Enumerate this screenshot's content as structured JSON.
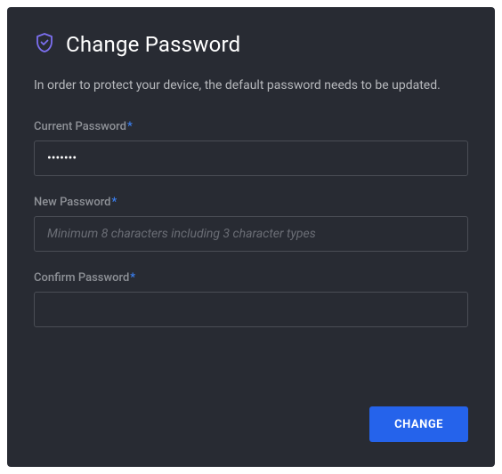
{
  "header": {
    "title": "Change Password"
  },
  "description": "In order to protect your device, the default password needs to be updated.",
  "form": {
    "current": {
      "label": "Current Password",
      "value": "•••••••"
    },
    "new": {
      "label": "New Password",
      "placeholder": "Minimum 8 characters including 3 character types",
      "value": ""
    },
    "confirm": {
      "label": "Confirm Password",
      "value": ""
    }
  },
  "actions": {
    "submit_label": "CHANGE"
  }
}
